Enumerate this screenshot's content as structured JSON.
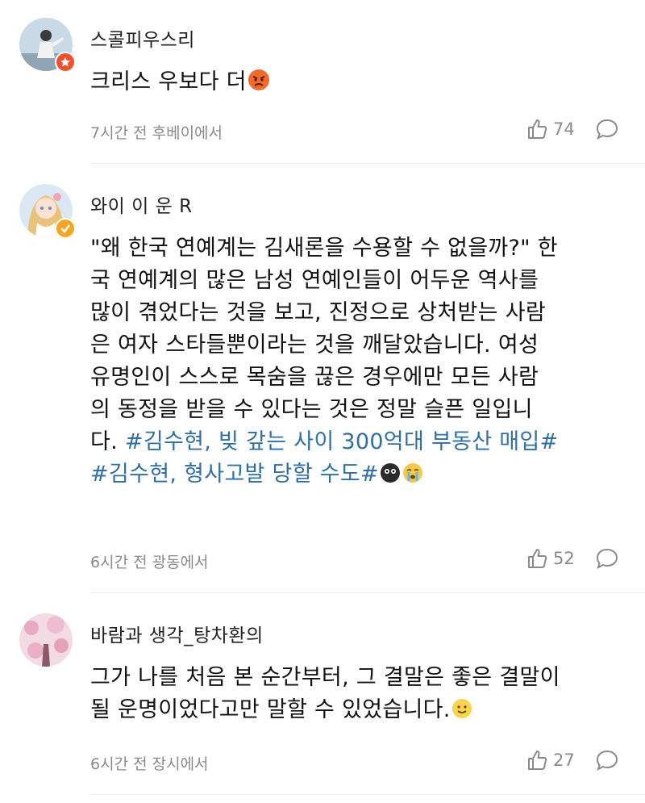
{
  "comments": [
    {
      "username": "스콜피우스리",
      "text": "크리스 우보다 더",
      "meta": "7시간 전 후베이에서",
      "likes": "74",
      "avatar_icon": "scorpion-avatar",
      "badge_color": "#f0502d"
    },
    {
      "username": "와이 이 운 R",
      "text_lines": [
        "\"왜 한국 연예계는 김새론을 수용할 수 없을까?\" 한",
        "국 연예계의 많은 남성 연예인들이 어두운 역사를",
        "많이 겪었다는 것을 보고, 진정으로 상처받는 사람",
        "은 여자 스타들뿐이라는 것을 깨달았습니다. 여성",
        "유명인이 스스로 목숨을 끊은 경우에만 모든 사람",
        "의 동정을 받을 수 있다는 것은 정말 슬픈 일입니"
      ],
      "text_last": "다.",
      "hashtag1": "#김수현, 빚 갚는 사이 300억대 부동산 매입#",
      "hashtag2": "#김수현, 형사고발 당할 수도#",
      "meta": "6시간 전 광동에서",
      "likes": "52",
      "avatar_icon": "doll-avatar",
      "badge_color": "#f5a623"
    },
    {
      "username": "바람과 생각_탕차환의",
      "text_lines": [
        "그가 나를 처음 본 순간부터, 그 결말은 좋은 결말이",
        "될 운명이었다고만 말할 수 있었습니다."
      ],
      "meta": "6시간 전 장시에서",
      "likes": "27",
      "avatar_icon": "blossom-avatar"
    }
  ],
  "colors": {
    "hashtag": "#2e6fa8",
    "meta": "#8a8a8a"
  }
}
